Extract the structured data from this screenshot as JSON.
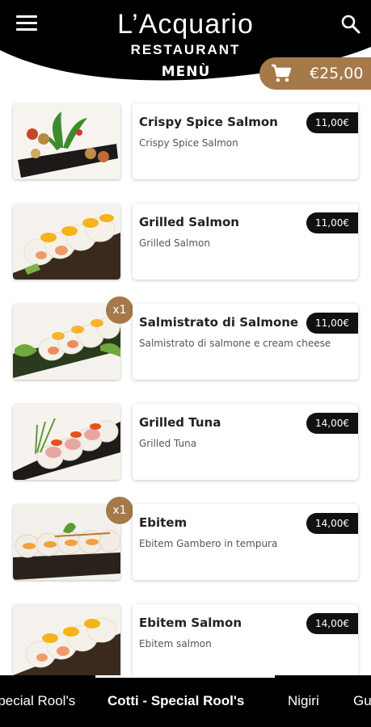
{
  "header": {
    "title": "L’Acquario",
    "subtitle": "RESTAURANT",
    "menu_label": "MENÙ",
    "cart_total": "€25,00",
    "icons": {
      "menu": "hamburger-menu-icon",
      "search": "search-icon",
      "cart": "shopping-cart-icon"
    },
    "colors": {
      "header": "#000000",
      "accent": "#a5794a"
    }
  },
  "items": [
    {
      "name": "Crispy Spice Salmon",
      "description": "Crispy Spice Salmon",
      "price": "11,00€",
      "quantity": null
    },
    {
      "name": "Grilled Salmon",
      "description": "Grilled Salmon",
      "price": "11,00€",
      "quantity": null
    },
    {
      "name": "Salmistrato di Salmone",
      "description": "Salmistrato di salmone e cream cheese",
      "price": "11,00€",
      "quantity": "x1"
    },
    {
      "name": "Grilled Tuna",
      "description": "Grilled Tuna",
      "price": "14,00€",
      "quantity": null
    },
    {
      "name": "Ebitem",
      "description": "Ebitem Gambero in tempura",
      "price": "14,00€",
      "quantity": "x1"
    },
    {
      "name": "Ebitem Salmon",
      "description": "Ebitem salmon",
      "price": "14,00€",
      "quantity": null
    }
  ],
  "tabs": [
    {
      "label": "Special Rool's",
      "active": false
    },
    {
      "label": "Cotti - Special Rool's",
      "active": true
    },
    {
      "label": "Nigiri",
      "active": false
    },
    {
      "label": "Gu",
      "active": false
    }
  ]
}
